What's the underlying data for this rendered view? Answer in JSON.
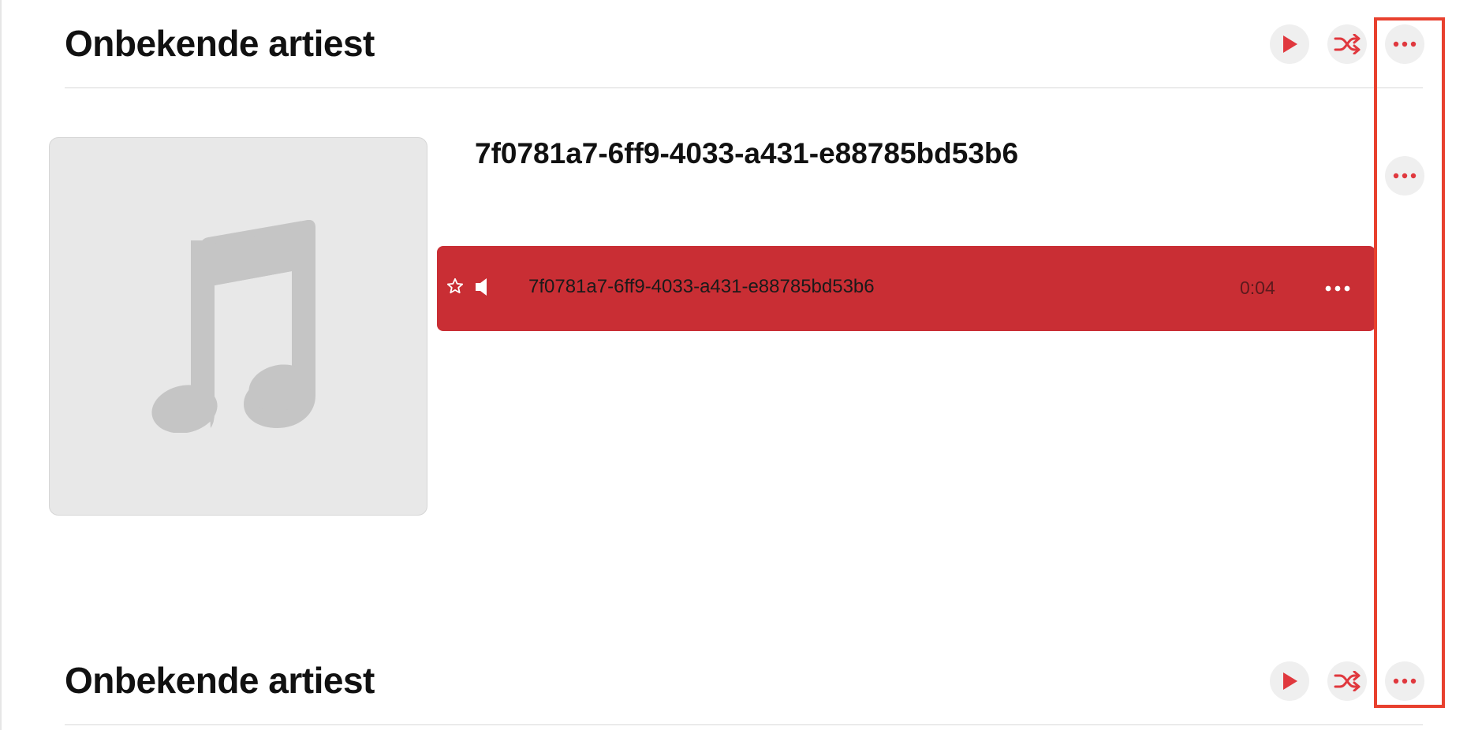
{
  "sections": [
    {
      "artist": "Onbekende artiest",
      "play_button": "play-icon",
      "shuffle_button": "shuffle-icon",
      "more_button": "more-icon"
    },
    {
      "artist": "Onbekende artiest",
      "play_button": "play-icon",
      "shuffle_button": "shuffle-icon",
      "more_button": "more-icon"
    }
  ],
  "album": {
    "title": "7f0781a7-6ff9-4033-a431-e88785bd53b6",
    "artwork_icon": "music-note-icon",
    "more_button": "more-icon",
    "tracks": [
      {
        "title": "7f0781a7-6ff9-4033-a431-e88785bd53b6",
        "duration": "0:04",
        "favorite_icon": "star-outline-icon",
        "now_playing_icon": "speaker-icon",
        "more_button": "more-icon",
        "selected": true
      }
    ]
  },
  "colors": {
    "accent": "#e0383e",
    "selected_row": "#c92e34",
    "highlight_box": "#e8402e",
    "button_bg": "#efefef"
  }
}
